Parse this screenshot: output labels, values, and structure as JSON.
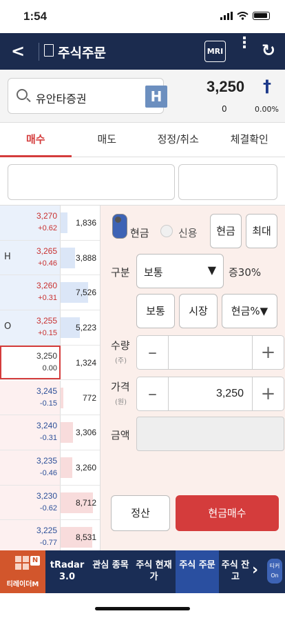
{
  "status_bar": {
    "time": "1:54"
  },
  "nav": {
    "title": "주식주문",
    "mri_label": "MRI"
  },
  "stock": {
    "name": "유안타증권",
    "badge": "H",
    "price": "3,250",
    "change": "0",
    "change_pct": "0.00%"
  },
  "tabs": [
    {
      "label": "매수",
      "active": true
    },
    {
      "label": "매도",
      "active": false
    },
    {
      "label": "정정/취소",
      "active": false
    },
    {
      "label": "체결확인",
      "active": false
    }
  ],
  "orderbook": {
    "rows": [
      {
        "side": "sell",
        "price": "3,270",
        "change": "+0.62",
        "volume": "1,836",
        "volume_ratio": 0.18,
        "mark": ""
      },
      {
        "side": "sell",
        "price": "3,265",
        "change": "+0.46",
        "volume": "3,888",
        "volume_ratio": 0.38,
        "mark": "H"
      },
      {
        "side": "sell",
        "price": "3,260",
        "change": "+0.31",
        "volume": "7,526",
        "volume_ratio": 0.72,
        "mark": ""
      },
      {
        "side": "sell",
        "price": "3,255",
        "change": "+0.15",
        "volume": "5,223",
        "volume_ratio": 0.5,
        "mark": "O"
      },
      {
        "side": "cur",
        "price": "3,250",
        "change": "0.00",
        "volume": "1,324",
        "volume_ratio": 0.13,
        "mark": ""
      },
      {
        "side": "buy",
        "price": "3,245",
        "change": "-0.15",
        "volume": "772",
        "volume_ratio": 0.08,
        "mark": ""
      },
      {
        "side": "buy",
        "price": "3,240",
        "change": "-0.31",
        "volume": "3,306",
        "volume_ratio": 0.32,
        "mark": ""
      },
      {
        "side": "buy",
        "price": "3,235",
        "change": "-0.46",
        "volume": "3,260",
        "volume_ratio": 0.31,
        "mark": ""
      },
      {
        "side": "buy",
        "price": "3,230",
        "change": "-0.62",
        "volume": "8,712",
        "volume_ratio": 0.84,
        "mark": ""
      },
      {
        "side": "buy",
        "price": "3,225",
        "change": "-0.77",
        "volume": "8,531",
        "volume_ratio": 0.82,
        "mark": ""
      }
    ]
  },
  "form": {
    "cash_label": "현금",
    "credit_label": "신용",
    "cash_btn": "현금",
    "max_btn": "최대",
    "type_label": "구분",
    "type_value": "보통",
    "margin_text": "증30%",
    "normal_btn": "보통",
    "market_btn": "시장",
    "cashpct_btn": "현금%",
    "qty_label": "수량",
    "qty_unit": "(주)",
    "price_label": "가격",
    "price_unit": "(원)",
    "price_value": "3,250",
    "amount_label": "금액",
    "reset_btn": "정산",
    "buy_btn": "현금매수"
  },
  "bottom_bar": {
    "logo_text": "티레이더M",
    "logo_badge": "N",
    "items": [
      "tRadar 3.0",
      "관심 종목",
      "주식 현재가",
      "주식 주문",
      "주식 잔고"
    ],
    "on_label": "티커 On"
  },
  "colors": {
    "nav_bg": "#1b2b4e",
    "accent_red": "#d43c3c",
    "sell_blue": "#2c4f98",
    "buy_red": "#c83030"
  }
}
